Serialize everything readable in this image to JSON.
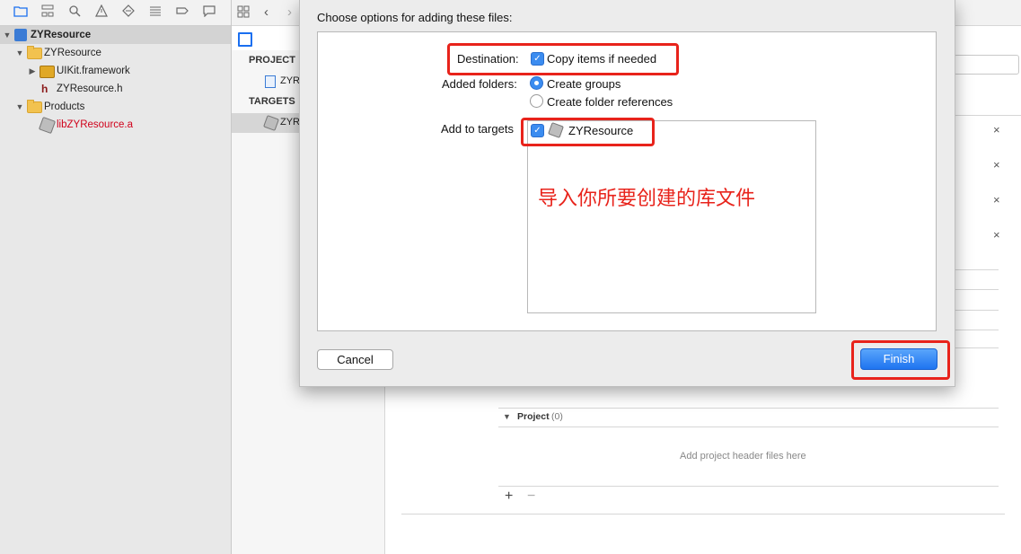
{
  "colors": {
    "accent": "#3b8cf0",
    "highlight": "#e8231b",
    "missing_file": "#d0021b"
  },
  "navigator": {
    "toolbar_icons": [
      "folder-icon",
      "hierarchy-icon",
      "search-icon",
      "warning-icon",
      "test-diamond-icon",
      "list-icon",
      "tag-icon",
      "comment-icon"
    ],
    "tree": [
      {
        "label": "ZYResource",
        "icon": "project-icon"
      },
      {
        "label": "ZYResource",
        "icon": "folder-icon"
      },
      {
        "label": "UIKit.framework",
        "icon": "toolbox-icon"
      },
      {
        "label": "h",
        "file": "ZYResource.h",
        "icon": "header-file-icon"
      },
      {
        "label": "Products",
        "icon": "folder-icon"
      },
      {
        "label": "libZYResource.a",
        "icon": "library-icon"
      }
    ]
  },
  "middle": {
    "project_header": "PROJECT",
    "project_item": "ZYR",
    "targets_header": "TARGETS",
    "target_item": "ZYR"
  },
  "sheet": {
    "title": "Choose options for adding these files:",
    "destination_label": "Destination:",
    "copy_items": "Copy items if needed",
    "added_folders_label": "Added folders:",
    "create_groups": "Create groups",
    "create_folder_refs": "Create folder references",
    "add_to_targets_label": "Add to targets",
    "target_name": "ZYResource",
    "annotation": "导入你所要创建的库文件",
    "cancel": "Cancel",
    "finish": "Finish"
  },
  "editor": {
    "project_section": "Project",
    "project_count": "(0)",
    "placeholder": "Add project header files here",
    "add": "+",
    "remove": "−",
    "close": "×"
  }
}
